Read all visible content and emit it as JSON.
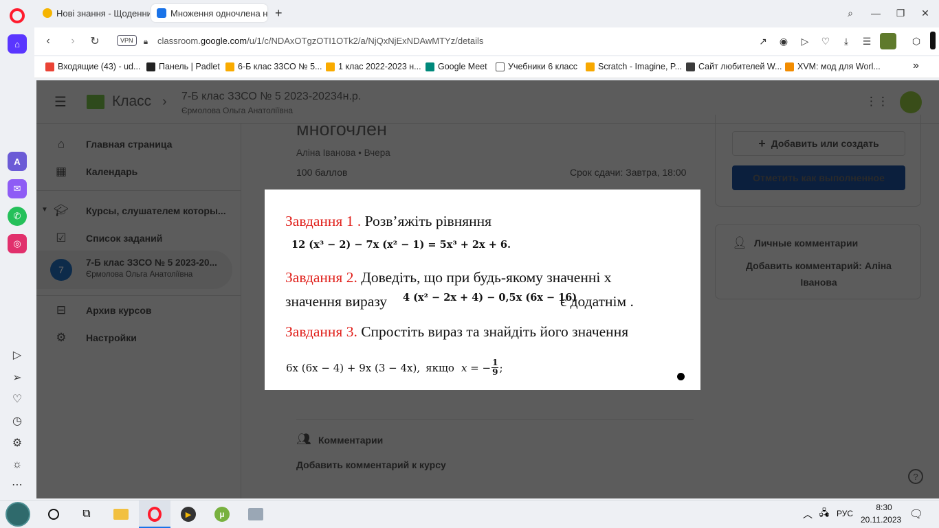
{
  "browser": {
    "tabs": [
      {
        "label": "Нові знання - Щоденник",
        "active": false
      },
      {
        "label": "Множення одночлена на",
        "active": true
      }
    ],
    "new_tab": "+",
    "url_prefix": "classroom.",
    "url_domain": "google.com",
    "url_path": "/u/1/c/NDAxOTgzOTI1OTk2/a/NjQxNjExNDAwMTYz/details",
    "vpn_label": "VPN",
    "bookmarks": [
      "Входящие (43) - ud...",
      "Панель | Padlet",
      "6-Б клас 33СО № 5...",
      "1 клас 2022-2023 н...",
      "Google Meet",
      "Учебники 6 класс",
      "Scratch - Imagine, P...",
      "Сайт любителей W...",
      "XVM: мод для Worl..."
    ],
    "bookmarks_more": "»"
  },
  "classroom": {
    "app_name": "Класс",
    "course_title": "7-Б клас ЗЗСО № 5 2023-20234н.р.",
    "teacher": "Єрмолова Ольга Анатоліївна",
    "sidebar": {
      "home": "Главная страница",
      "calendar": "Календарь",
      "enrolled": "Курсы, слушателем которы...",
      "todo": "Список заданий",
      "course_avatar": "7",
      "course_name": "7-Б клас ЗЗСО № 5 2023-20...",
      "course_teacher": "Єрмолова Ольга Анатоліївна",
      "archive": "Архив курсов",
      "settings": "Настройки"
    },
    "assignment": {
      "title_fragment": "многочлен",
      "author_line": "Аліна Іванова • Вчера",
      "points": "100 баллов",
      "due": "Срок сдачи: Завтра, 18:00",
      "class_comments": "Комментарии",
      "add_class_comment": "Добавить комментарий к курсу"
    },
    "work": {
      "add_create": "Добавить или создать",
      "mark_done": "Отметить как выполненное"
    },
    "private": {
      "title": "Личные комментарии",
      "add": "Добавить комментарий: Аліна Іванова"
    },
    "help": "?"
  },
  "modal": {
    "task1_label": "Завдання 1 .",
    "task1_text": "Розв’яжіть рівняння",
    "task1_formula": "12 (x³ − 2) − 7x (x² − 1) = 5x³ + 2x + 6.",
    "task2_label": "Завдання 2.",
    "task2_text": "Доведіть, що при будь-якому значенні х",
    "task2_line2_a": "значення виразу",
    "task2_formula": "4 (x² − 2x + 4) − 0,5x (6x − 16)",
    "task2_line2_b": "є додатнім .",
    "task3_label": "Завдання 3.",
    "task3_text": "Спростіть вираз та знайдіть його значення",
    "task3_formula": "6x (6x − 4) + 9x (3 − 4x),",
    "task3_if": "якщо",
    "task3_x": "x = −",
    "task3_num": "1",
    "task3_den": "9",
    "task3_end": ";"
  },
  "taskbar": {
    "lang": "РУС",
    "time": "8:30",
    "date": "20.11.2023"
  },
  "colors": {
    "accent_red": "#e0201b",
    "opera_red": "#ff1b2d",
    "mark_done_bg": "#0b1f3d"
  }
}
